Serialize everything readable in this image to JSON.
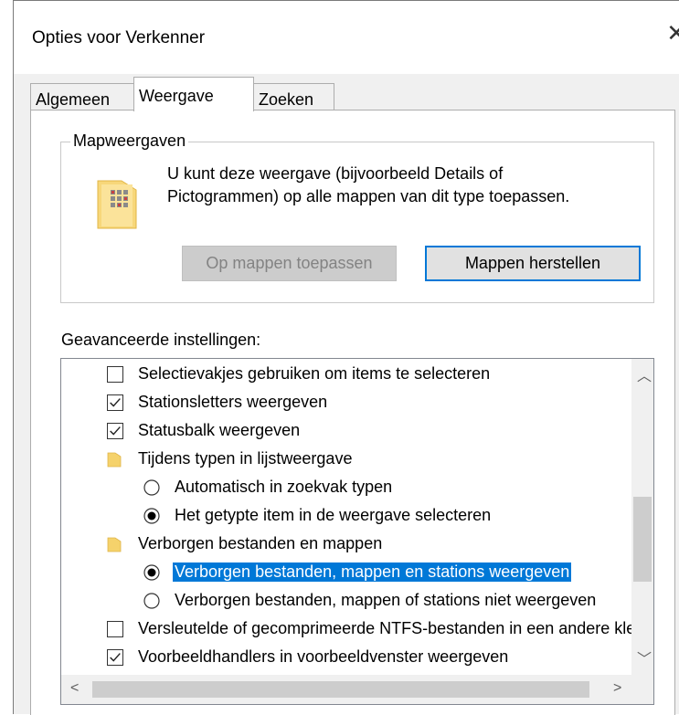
{
  "window": {
    "title": "Opties voor Verkenner"
  },
  "tabs": [
    {
      "label": "Algemeen",
      "active": false
    },
    {
      "label": "Weergave",
      "active": true
    },
    {
      "label": "Zoeken",
      "active": false
    }
  ],
  "folder_views": {
    "legend": "Mapweergaven",
    "description": "U kunt deze weergave (bijvoorbeeld Details of Pictogrammen) op alle mappen van dit type toepassen.",
    "apply_button": "Op mappen toepassen",
    "reset_button": "Mappen herstellen"
  },
  "advanced": {
    "label": "Geavanceerde instellingen:",
    "items": [
      {
        "type": "checkbox",
        "checked": false,
        "label": "Selectievakjes gebruiken om items te selecteren"
      },
      {
        "type": "checkbox",
        "checked": true,
        "label": "Stationsletters weergeven"
      },
      {
        "type": "checkbox",
        "checked": true,
        "label": "Statusbalk weergeven"
      },
      {
        "type": "folder",
        "label": "Tijdens typen in lijstweergave"
      },
      {
        "type": "radio",
        "checked": false,
        "label": "Automatisch in zoekvak typen"
      },
      {
        "type": "radio",
        "checked": true,
        "label": "Het getypte item in de weergave selecteren"
      },
      {
        "type": "folder",
        "label": "Verborgen bestanden en mappen"
      },
      {
        "type": "radio",
        "checked": true,
        "selected": true,
        "label": "Verborgen bestanden, mappen en stations weergeven"
      },
      {
        "type": "radio",
        "checked": false,
        "label": "Verborgen bestanden, mappen of stations niet weergeven"
      },
      {
        "type": "checkbox",
        "checked": false,
        "label": "Versleutelde of gecomprimeerde NTFS-bestanden in een andere kleur weergeven"
      },
      {
        "type": "checkbox",
        "checked": true,
        "label": "Voorbeeldhandlers in voorbeeldvenster weergeven"
      }
    ]
  },
  "colors": {
    "selection": "#0078d7",
    "folder": "#f5d26b"
  }
}
